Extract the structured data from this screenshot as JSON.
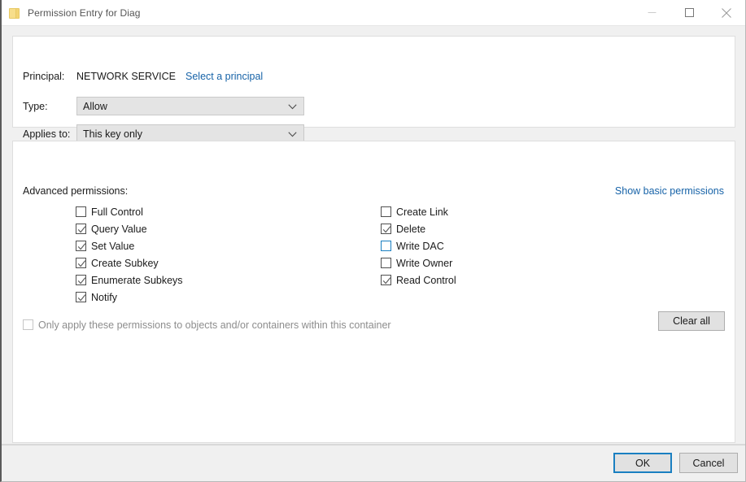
{
  "window": {
    "title": "Permission Entry for Diag",
    "icon": "folder-icon",
    "controls": {
      "minimize": "minimize-icon",
      "maximize": "maximize-icon",
      "close": "close-icon"
    }
  },
  "principal_panel": {
    "principal_label": "Principal:",
    "principal_value": "NETWORK SERVICE",
    "select_principal_link": "Select a principal",
    "type_label": "Type:",
    "type_value": "Allow",
    "applies_to_label": "Applies to:",
    "applies_to_value": "This key only"
  },
  "permissions_panel": {
    "section_label": "Advanced permissions:",
    "show_basic_link": "Show basic permissions",
    "left_column": [
      {
        "label": "Full Control",
        "checked": false,
        "focused": false,
        "disabled": false
      },
      {
        "label": "Query Value",
        "checked": true,
        "focused": false,
        "disabled": false
      },
      {
        "label": "Set Value",
        "checked": true,
        "focused": false,
        "disabled": false
      },
      {
        "label": "Create Subkey",
        "checked": true,
        "focused": false,
        "disabled": false
      },
      {
        "label": "Enumerate Subkeys",
        "checked": true,
        "focused": false,
        "disabled": false
      },
      {
        "label": "Notify",
        "checked": true,
        "focused": false,
        "disabled": false
      }
    ],
    "right_column": [
      {
        "label": "Create Link",
        "checked": false,
        "focused": false,
        "disabled": false
      },
      {
        "label": "Delete",
        "checked": true,
        "focused": false,
        "disabled": false
      },
      {
        "label": "Write DAC",
        "checked": false,
        "focused": true,
        "disabled": false
      },
      {
        "label": "Write Owner",
        "checked": false,
        "focused": false,
        "disabled": false
      },
      {
        "label": "Read Control",
        "checked": true,
        "focused": false,
        "disabled": false
      }
    ],
    "container_only": {
      "label": "Only apply these permissions to objects and/or containers within this container",
      "checked": false,
      "disabled": true
    },
    "clear_all_label": "Clear all"
  },
  "footer": {
    "ok_label": "OK",
    "cancel_label": "Cancel"
  },
  "colors": {
    "accent_link": "#1763a8",
    "focus_blue": "#1a7fc1",
    "dialog_bg": "#f0f0f0",
    "panel_bg": "#ffffff",
    "combo_bg": "#e4e4e4",
    "button_bg": "#e1e1e1"
  }
}
